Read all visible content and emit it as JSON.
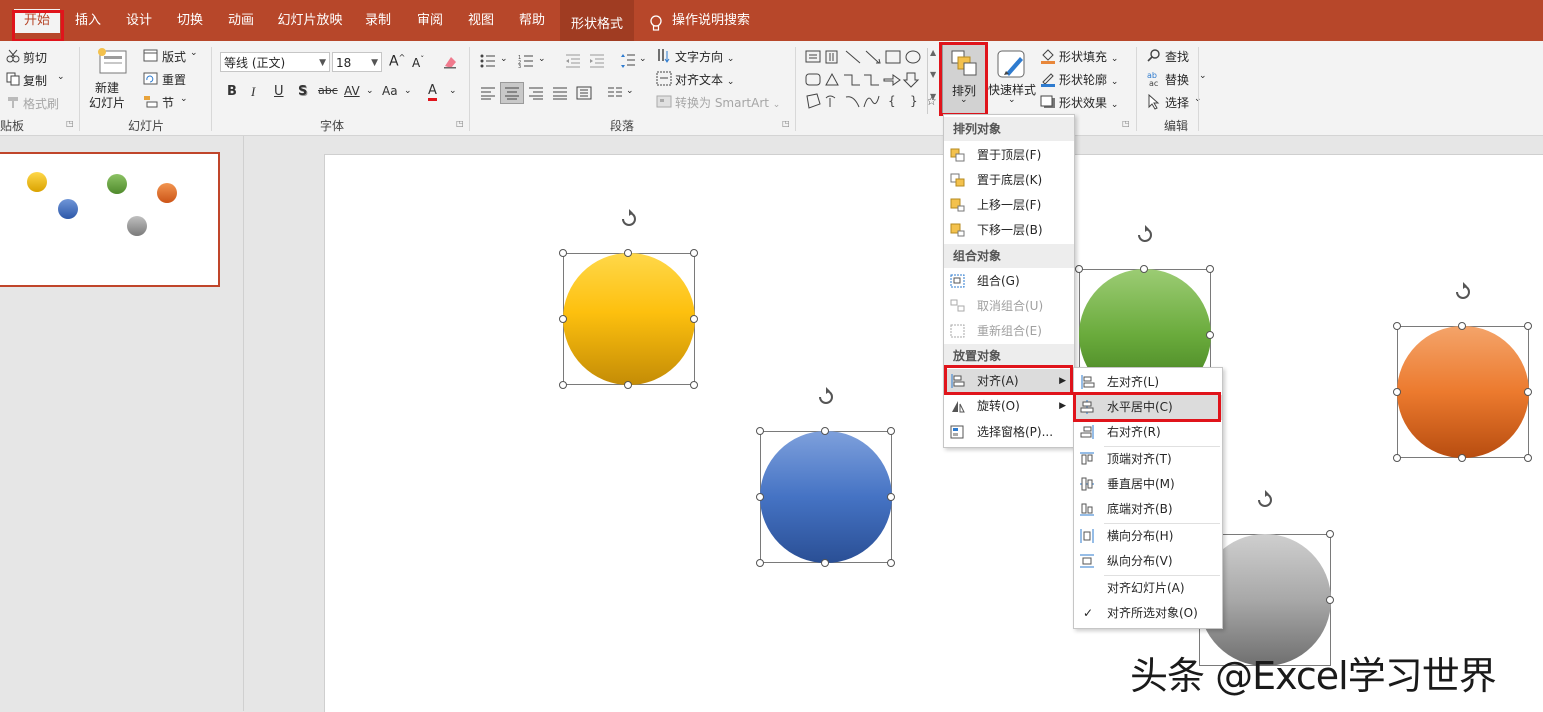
{
  "colors": {
    "accent": "#b7472a",
    "highlight_box": "#e0141b"
  },
  "tabs": [
    "开始",
    "插入",
    "设计",
    "切换",
    "动画",
    "幻灯片放映",
    "录制",
    "审阅",
    "视图",
    "帮助",
    "形状格式"
  ],
  "tell_me": "操作说明搜索",
  "clipboard": {
    "cut": "剪切",
    "copy": "复制",
    "format_painter": "格式刷",
    "label": "贴板"
  },
  "slides": {
    "new_slide": "新建\n幻灯片",
    "layout": "版式",
    "reset": "重置",
    "section": "节",
    "label": "幻灯片"
  },
  "font": {
    "name": "等线 (正文)",
    "size": "18",
    "label": "字体",
    "increase": "A",
    "decrease": "A",
    "clear": "clear-format-icon",
    "bold": "B",
    "italic": "I",
    "underline": "U",
    "shadow": "S",
    "strike": "abc",
    "spacing": "AV",
    "case": "Aa",
    "color": "A"
  },
  "paragraph": {
    "text_direction": "文字方向",
    "align_text": "对齐文本",
    "smartart": "转换为 SmartArt",
    "label": "段落"
  },
  "drawing": {
    "arrange": "排列",
    "quick_styles": "快速样式",
    "shape_fill": "形状填充",
    "shape_outline": "形状轮廓",
    "shape_effects": "形状效果"
  },
  "editing": {
    "find": "查找",
    "replace": "替换",
    "select": "选择",
    "label": "编辑"
  },
  "arrange_menu": {
    "header_order": "排列对象",
    "bring_front": "置于顶层(F)",
    "send_back": "置于底层(K)",
    "bring_forward": "上移一层(F)",
    "send_backward": "下移一层(B)",
    "header_group": "组合对象",
    "group": "组合(G)",
    "ungroup": "取消组合(U)",
    "regroup": "重新组合(E)",
    "header_position": "放置对象",
    "align": "对齐(A)",
    "rotate": "旋转(O)",
    "selection_pane": "选择窗格(P)..."
  },
  "align_menu": {
    "left": "左对齐(L)",
    "center": "水平居中(C)",
    "right": "右对齐(R)",
    "top": "顶端对齐(T)",
    "middle": "垂直居中(M)",
    "bottom": "底端对齐(B)",
    "dist_h": "横向分布(H)",
    "dist_v": "纵向分布(V)",
    "to_slide": "对齐幻灯片(A)",
    "to_selected": "对齐所选对象(O)",
    "check": "✓"
  },
  "watermark": "头条 @Excel学习世界"
}
